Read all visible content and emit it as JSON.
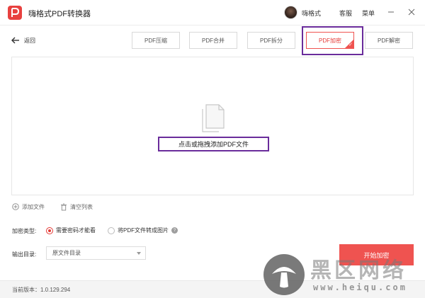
{
  "window": {
    "title": "嗨格式PDF转换器",
    "username": "嗨格式",
    "service_label": "客服",
    "menu_label": "菜单"
  },
  "nav": {
    "back_label": "返回",
    "tabs": [
      {
        "label": "PDF压缩",
        "active": false
      },
      {
        "label": "PDF合并",
        "active": false
      },
      {
        "label": "PDF拆分",
        "active": false
      },
      {
        "label": "PDF加密",
        "active": true
      },
      {
        "label": "PDF解密",
        "active": false
      }
    ]
  },
  "dropzone": {
    "text": "点击或拖拽添加PDF文件"
  },
  "file_actions": {
    "add_label": "添加文件",
    "clear_label": "清空列表"
  },
  "options": {
    "encrypt_type_label": "加密类型:",
    "radio_password": "需要密码才能看",
    "radio_image": "将PDF文件转成图片",
    "selected": "radio_password",
    "output_label": "输出目录:",
    "output_value": "原文件目录"
  },
  "actions": {
    "start_label": "开始加密"
  },
  "status": {
    "version": "当前版本：1.0.129.294"
  },
  "watermark": {
    "text": "黑区网络",
    "url": "www.heiqu.com"
  },
  "colors": {
    "accent": "#ef5350",
    "highlight": "#6a2c9b"
  }
}
